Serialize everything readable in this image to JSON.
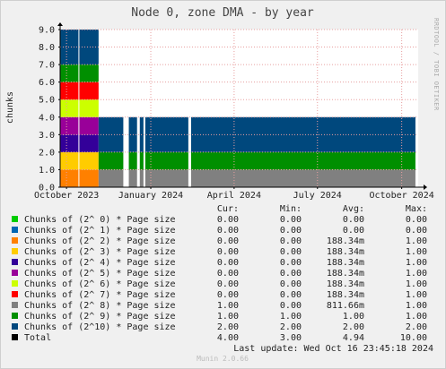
{
  "chart_data": {
    "type": "area",
    "stacked": true,
    "title": "Node 0, zone DMA - by year",
    "ylabel": "chunks",
    "ylim": [
      0,
      9
    ],
    "yticks": [
      "0.0",
      "1.0",
      "2.0",
      "3.0",
      "4.0",
      "5.0",
      "6.0",
      "7.0",
      "8.0",
      "9.0"
    ],
    "xticks": [
      "October 2023",
      "January 2024",
      "April 2024",
      "July 2024",
      "October 2024"
    ],
    "grid": true,
    "side_text": "RRDTOOL / TOBI OETIKER",
    "columns": [
      "Cur:",
      "Min:",
      "Avg:",
      "Max:"
    ],
    "series": [
      {
        "name": "Chunks of (2^ 0) * Page size",
        "color": "#00cc00",
        "cur": "0.00",
        "min": "0.00",
        "avg": "0.00",
        "max": "0.00"
      },
      {
        "name": "Chunks of (2^ 1) * Page size",
        "color": "#0066b3",
        "cur": "0.00",
        "min": "0.00",
        "avg": "0.00",
        "max": "0.00"
      },
      {
        "name": "Chunks of (2^ 2) * Page size",
        "color": "#ff8000",
        "cur": "0.00",
        "min": "0.00",
        "avg": "188.34m",
        "max": "1.00"
      },
      {
        "name": "Chunks of (2^ 3) * Page size",
        "color": "#ffcc00",
        "cur": "0.00",
        "min": "0.00",
        "avg": "188.34m",
        "max": "1.00"
      },
      {
        "name": "Chunks of (2^ 4) * Page size",
        "color": "#330099",
        "cur": "0.00",
        "min": "0.00",
        "avg": "188.34m",
        "max": "1.00"
      },
      {
        "name": "Chunks of (2^ 5) * Page size",
        "color": "#990099",
        "cur": "0.00",
        "min": "0.00",
        "avg": "188.34m",
        "max": "1.00"
      },
      {
        "name": "Chunks of (2^ 6) * Page size",
        "color": "#ccff00",
        "cur": "0.00",
        "min": "0.00",
        "avg": "188.34m",
        "max": "1.00"
      },
      {
        "name": "Chunks of (2^ 7) * Page size",
        "color": "#ff0000",
        "cur": "0.00",
        "min": "0.00",
        "avg": "188.34m",
        "max": "1.00"
      },
      {
        "name": "Chunks of (2^ 8) * Page size",
        "color": "#808080",
        "cur": "1.00",
        "min": "0.00",
        "avg": "811.66m",
        "max": "1.00"
      },
      {
        "name": "Chunks of (2^ 9) * Page size",
        "color": "#008f00",
        "cur": "1.00",
        "min": "1.00",
        "avg": "1.00",
        "max": "1.00"
      },
      {
        "name": "Chunks of (2^10) * Page size",
        "color": "#00487d",
        "cur": "2.00",
        "min": "2.00",
        "avg": "2.00",
        "max": "2.00"
      },
      {
        "name": "Total",
        "color": "#000000",
        "cur": "4.00",
        "min": "3.00",
        "avg": "4.94",
        "max": "10.00"
      }
    ],
    "phases": [
      {
        "until": "2023-11-05",
        "values": [
          0,
          0,
          1,
          1,
          1,
          1,
          1,
          1,
          0,
          1,
          2
        ]
      },
      {
        "until": "2024-10-16",
        "values": [
          0,
          0,
          0,
          0,
          0,
          0,
          0,
          0,
          1,
          1,
          2
        ]
      }
    ],
    "x_range": [
      "2023-09-24",
      "2024-10-19"
    ],
    "gaps": [
      {
        "from": "2023-10-14",
        "to": "2023-10-15"
      },
      {
        "from": "2023-12-02",
        "to": "2023-12-08"
      },
      {
        "from": "2023-12-17",
        "to": "2023-12-20"
      },
      {
        "from": "2023-12-24",
        "to": "2023-12-26"
      },
      {
        "from": "2024-02-11",
        "to": "2024-02-14"
      }
    ],
    "last_update": "Last update: Wed Oct 16 23:45:18 2024",
    "footer": "Munin 2.0.66"
  }
}
